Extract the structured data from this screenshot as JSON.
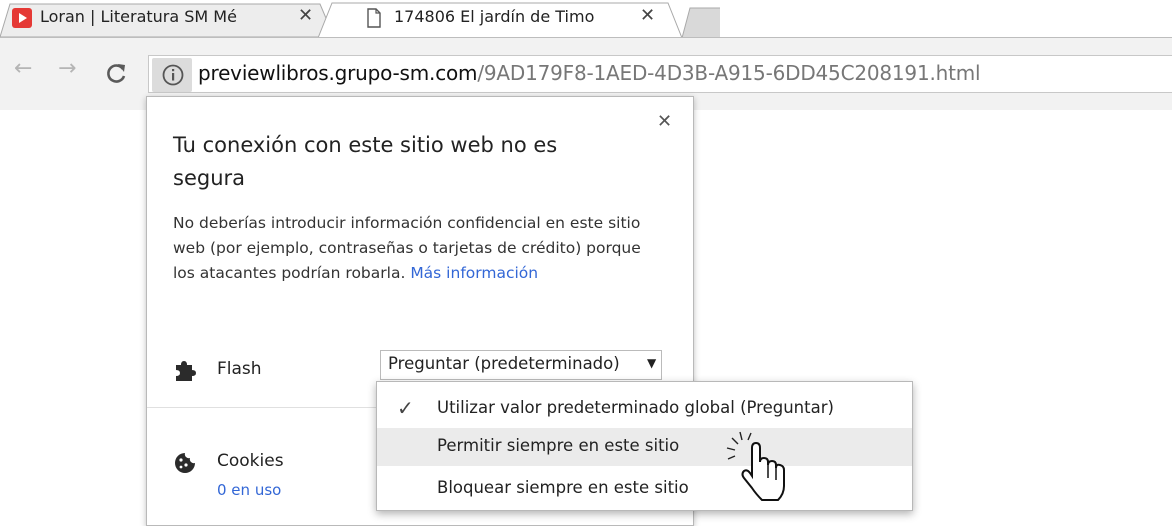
{
  "tabs": [
    {
      "title": "Loran | Literatura SM Mé",
      "icon": "red-play-favicon-icon",
      "active": false
    },
    {
      "title": "174806 El jardín de Timo",
      "icon": "page-icon",
      "active": true
    }
  ],
  "toolbar": {
    "url_host": "previewlibros.grupo-sm.com",
    "url_path": "/9AD179F8-1AED-4D3B-A915-6DD45C208191.html"
  },
  "popup": {
    "title": "Tu conexión con este sitio web no es segura",
    "body": "No deberías introducir información confidencial en este sitio web (por ejemplo, contraseñas o tarjetas de crédito) porque los atacantes podrían robarla.",
    "link": "Más información",
    "flash_label": "Flash",
    "flash_value": "Preguntar (predeterminado)",
    "cookies_label": "Cookies",
    "cookies_sub": "0 en uso"
  },
  "menu": {
    "items": [
      {
        "label": "Utilizar valor predeterminado global (Preguntar)",
        "checked": true,
        "highlighted": false
      },
      {
        "label": "Permitir siempre en este sitio",
        "checked": false,
        "highlighted": true
      },
      {
        "label": "Bloquear siempre en este sitio",
        "checked": false,
        "highlighted": false
      }
    ]
  },
  "colors": {
    "link": "#3367d6",
    "favicon_red": "#e53935",
    "toolbar_bg": "#f2f2f2"
  }
}
